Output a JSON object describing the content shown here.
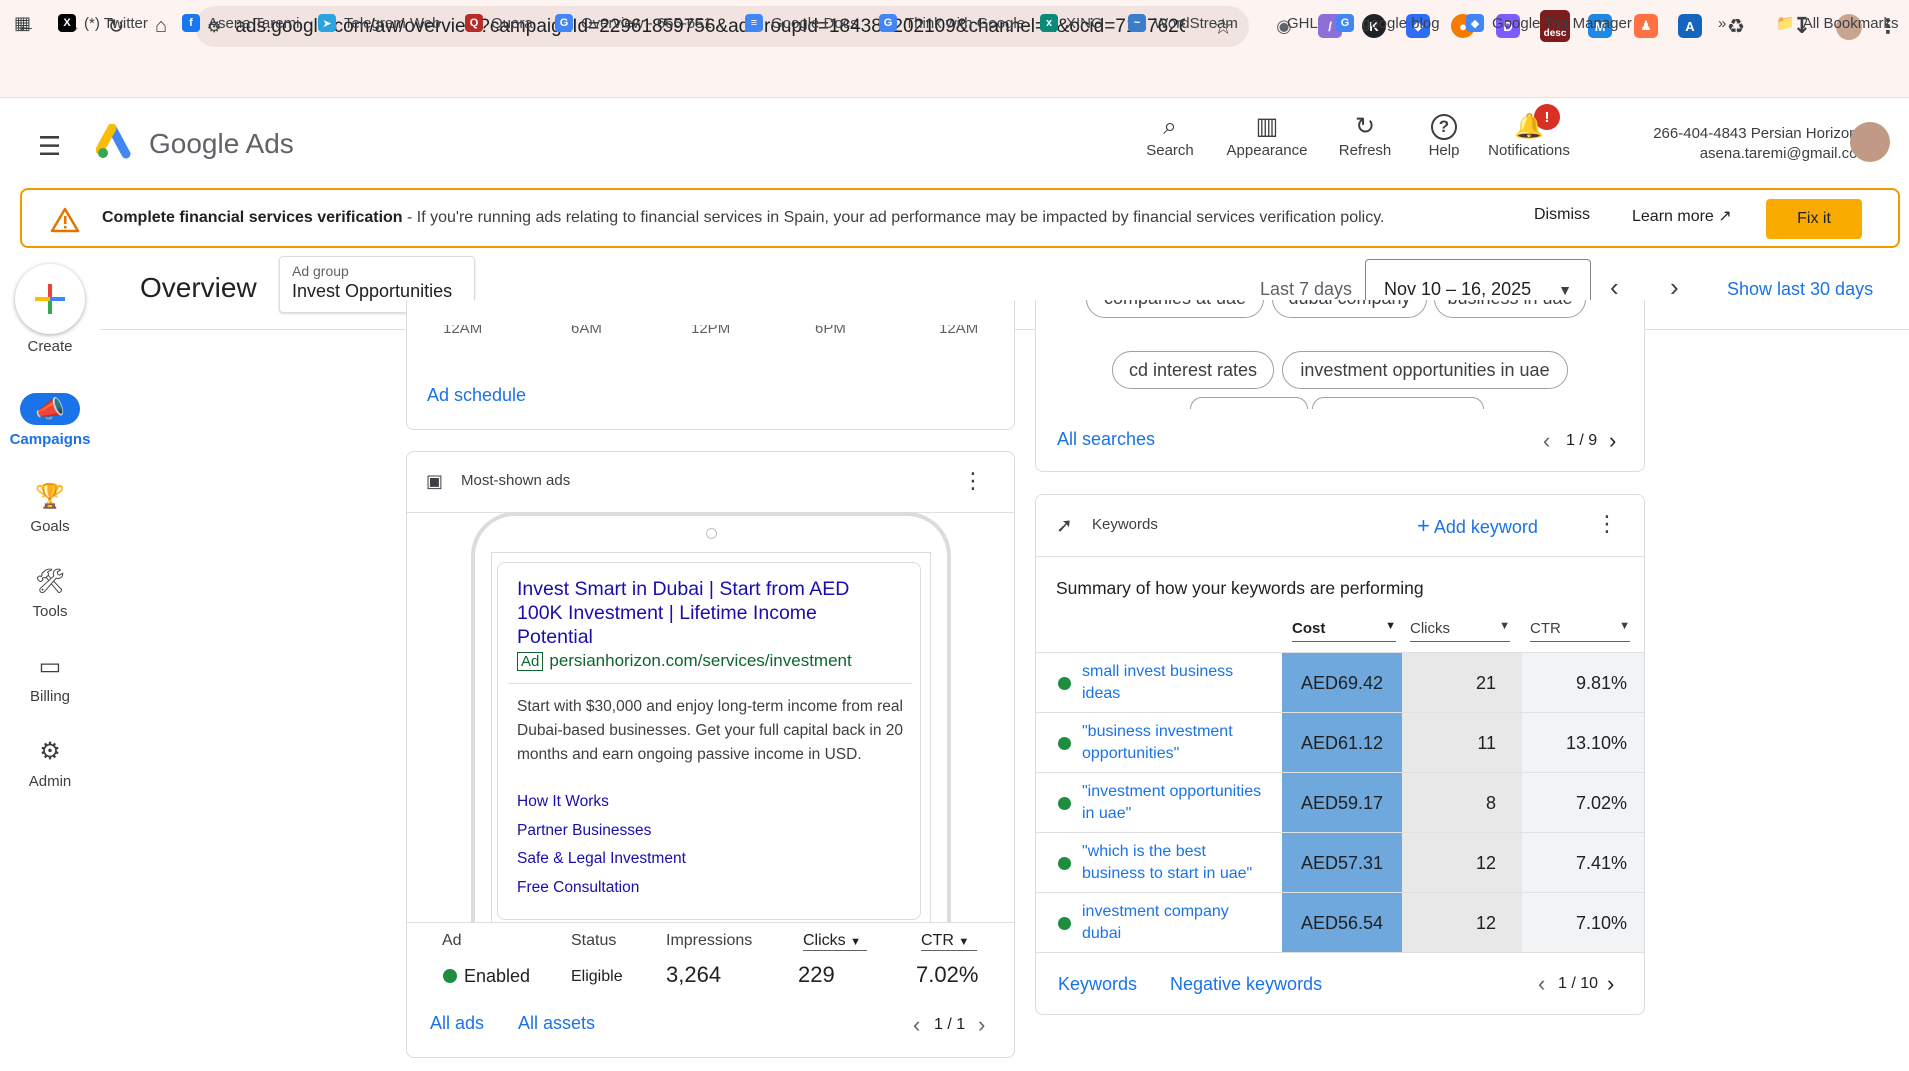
{
  "browser": {
    "url": "ads.google.com/aw/overview?campaignId=22961859756&adGroupId=184381202109&channel=1&ocid=7157626967&w...",
    "bookmarks": [
      {
        "label": "(*) Twitter",
        "icon": "x-icon",
        "color": "#000000"
      },
      {
        "label": "Asena Taremi",
        "icon": "facebook-icon",
        "color": "#1877f2"
      },
      {
        "label": "Telegram Web",
        "icon": "telegram-icon",
        "color": "#2aa3df"
      },
      {
        "label": "Quora",
        "icon": "quora-icon",
        "color": "#b92b27"
      },
      {
        "label": "Overview - 665-651...",
        "icon": "google-icon",
        "color": "#4285f4"
      },
      {
        "label": "Google Docs",
        "icon": "docs-icon",
        "color": "#4285f4"
      },
      {
        "label": "Think with Google",
        "icon": "google-icon",
        "color": "#4285f4"
      },
      {
        "label": "XING",
        "icon": "xing-icon",
        "color": "#0a8a7a"
      },
      {
        "label": "WordStream",
        "icon": "wordstream-icon",
        "color": "#3d7cc9"
      },
      {
        "label": "GHL",
        "icon": "",
        "color": ""
      },
      {
        "label": "google blog",
        "icon": "google-icon",
        "color": "#4285f4"
      },
      {
        "label": "Google Tag Manager",
        "icon": "tag-manager-icon",
        "color": "#4285f4"
      }
    ],
    "more_bookmarks": "»",
    "all_bookmarks": "All Bookmarks",
    "ext_badge": "desc"
  },
  "header": {
    "product_google": "Google",
    "product_ads": "Ads",
    "tools": [
      {
        "label": "Search",
        "icon": "search-icon"
      },
      {
        "label": "Appearance",
        "icon": "appearance-icon"
      },
      {
        "label": "Refresh",
        "icon": "refresh-icon"
      },
      {
        "label": "Help",
        "icon": "help-icon"
      },
      {
        "label": "Notifications",
        "icon": "bell-icon"
      }
    ],
    "notif_badge": "!",
    "account_line1": "266-404-4843 Persian Horizon...",
    "account_line2": "asena.taremi@gmail.com"
  },
  "banner": {
    "title": "Complete financial services verification",
    "body": " - If you're running ads relating to financial services in Spain, your ad performance may be impacted by financial services verification policy.",
    "dismiss": "Dismiss",
    "learn_more": "Learn more",
    "fix_it": "Fix it"
  },
  "rail": {
    "create": "Create",
    "items": [
      {
        "label": "Campaigns",
        "icon": "campaigns-icon",
        "active": true
      },
      {
        "label": "Goals",
        "icon": "trophy-icon",
        "active": false
      },
      {
        "label": "Tools",
        "icon": "tools-icon",
        "active": false
      },
      {
        "label": "Billing",
        "icon": "card-icon",
        "active": false
      },
      {
        "label": "Admin",
        "icon": "gear-icon",
        "active": false
      }
    ]
  },
  "overview": {
    "title": "Overview",
    "adgroup_label": "Ad group",
    "adgroup_name": "Invest Opportunities",
    "date_range_label": "Last 7 days",
    "date_range": "Nov 10 – 16, 2025",
    "show_last": "Show last 30 days"
  },
  "schedule_card": {
    "axis": [
      "12AM",
      "6AM",
      "12PM",
      "6PM",
      "12AM"
    ],
    "link": "Ad schedule"
  },
  "ads_card": {
    "title": "Most-shown ads",
    "ad_headline": "Invest Smart in Dubai | Start from AED 100K Investment | Lifetime Income Potential",
    "ad_badge": "Ad",
    "ad_url": "persianhorizon.com/services/investment",
    "ad_desc": "Start with $30,000 and enjoy long-term income from real Dubai-based businesses. Get your full capital back in 20 months and earn ongoing passive income in USD.",
    "sitelinks": [
      "How It Works",
      "Partner Businesses",
      "Safe & Legal Investment",
      "Free Consultation"
    ],
    "cols": {
      "ad": "Ad",
      "status": "Status",
      "impressions": "Impressions",
      "clicks": "Clicks",
      "ctr": "CTR"
    },
    "row": {
      "ad": "Enabled",
      "status": "Eligible",
      "impressions": "3,264",
      "clicks": "229",
      "ctr": "7.02%"
    },
    "links": {
      "all_ads": "All ads",
      "all_assets": "All assets"
    },
    "pager": "1 / 1"
  },
  "searches_card": {
    "chips_top": [
      "companies at uae",
      "dubai company",
      "business in uae"
    ],
    "chips": [
      "cd interest rates",
      "investment opportunities in uae"
    ],
    "link": "All searches",
    "pager": "1 / 9"
  },
  "keywords_card": {
    "title": "Keywords",
    "add": "Add keyword",
    "summary": "Summary of how your keywords are performing",
    "cols": {
      "cost": "Cost",
      "clicks": "Clicks",
      "ctr": "CTR"
    },
    "rows": [
      {
        "name": "small invest business ideas",
        "cost": "AED69.42",
        "clicks": "21",
        "ctr": "9.81%"
      },
      {
        "name": "\"business investment opportunities\"",
        "cost": "AED61.12",
        "clicks": "11",
        "ctr": "13.10%"
      },
      {
        "name": "\"investment opportunities in uae\"",
        "cost": "AED59.17",
        "clicks": "8",
        "ctr": "7.02%"
      },
      {
        "name": "\"which is the best business to start in uae\"",
        "cost": "AED57.31",
        "clicks": "12",
        "ctr": "7.41%"
      },
      {
        "name": "investment company dubai",
        "cost": "AED56.54",
        "clicks": "12",
        "ctr": "7.10%"
      }
    ],
    "links": {
      "keywords": "Keywords",
      "negative": "Negative keywords"
    },
    "pager": "1 / 10"
  },
  "colors": {
    "accent": "#1a73e8",
    "warning": "#f29900",
    "fix_button": "#f9ab00",
    "cost_highlight": "#6fa8dc",
    "enabled_green": "#1e8e3e"
  }
}
